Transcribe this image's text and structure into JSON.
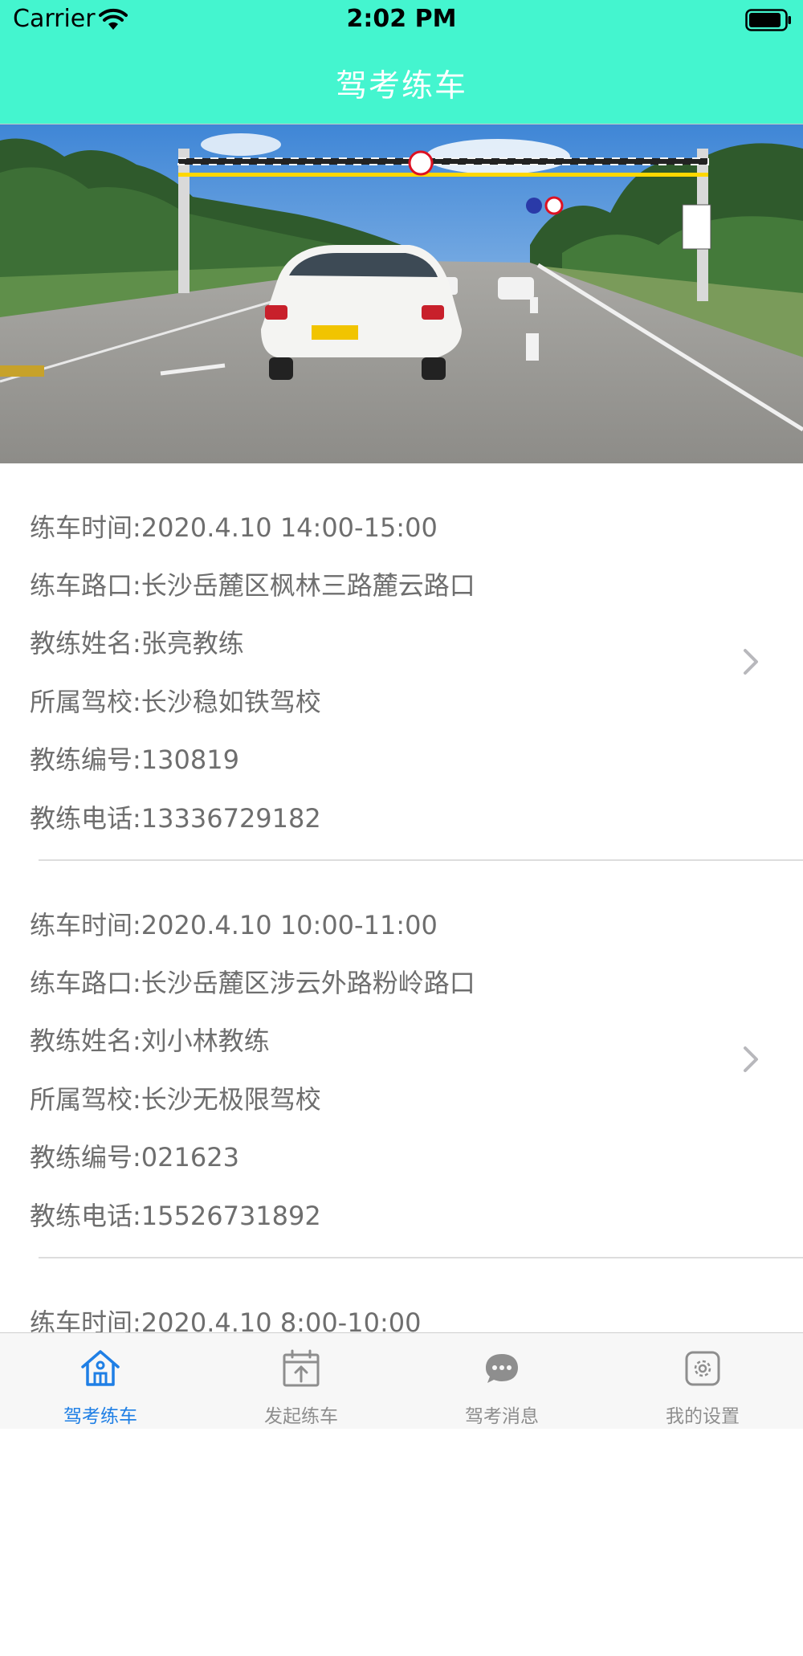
{
  "status_bar": {
    "carrier": "Carrier",
    "time": "2:02 PM"
  },
  "nav": {
    "title": "驾考练车"
  },
  "colors": {
    "accent": "#44f5cf",
    "tab_active": "#1f7fe5",
    "tab_inactive": "#8e8e8e",
    "body_text": "#6e6e6e"
  },
  "banner": {
    "description_icon": "driving-test-car-photo"
  },
  "records": [
    {
      "time": "练车时间:2020.4.10 14:00-15:00",
      "location": "练车路口:长沙岳麓区枫林三路麓云路口",
      "coach_name": "教练姓名:张亮教练",
      "school": "所属驾校:长沙稳如铁驾校",
      "coach_id": "教练编号:130819",
      "phone": "教练电话:13336729182"
    },
    {
      "time": "练车时间:2020.4.10 10:00-11:00",
      "location": "练车路口:长沙岳麓区涉云外路粉岭路口",
      "coach_name": "教练姓名:刘小林教练",
      "school": "所属驾校:长沙无极限驾校",
      "coach_id": "教练编号:021623",
      "phone": "教练电话:15526731892"
    },
    {
      "time": "练车时间:2020.4.10 8:00-10:00"
    }
  ],
  "tabs": [
    {
      "label": "驾考练车",
      "icon": "home-icon",
      "active": true
    },
    {
      "label": "发起练车",
      "icon": "calendar-upload-icon",
      "active": false
    },
    {
      "label": "驾考消息",
      "icon": "chat-bubble-icon",
      "active": false
    },
    {
      "label": "我的设置",
      "icon": "settings-icon",
      "active": false
    }
  ]
}
